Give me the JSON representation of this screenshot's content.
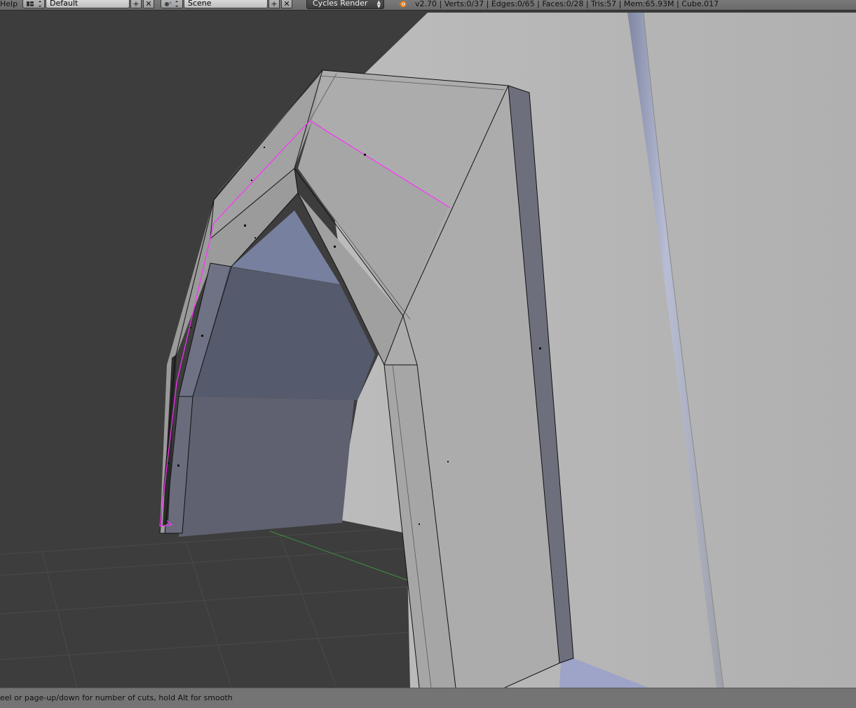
{
  "header": {
    "help_menu": "Help",
    "layout_name": "Default",
    "scene_name": "Scene",
    "render_engine": "Cycles Render",
    "stats": "v2.70 | Verts:0/37 | Edges:0/65 | Faces:0/28 | Tris:57 | Mem:65.93M | Cube.017",
    "add_icon": "plus-icon",
    "remove_icon": "close-icon",
    "layout_icon": "screen-layout-icon",
    "scene_icon": "scene-icon",
    "blender_icon": "blender-logo-icon"
  },
  "status_bar": {
    "hint": "eel or page-up/down for number of cuts, hold Alt for smooth"
  },
  "colors": {
    "background": "#3d3d3d",
    "mesh_face": "#a9a9a9",
    "selection_edge": "#ff30ff",
    "x_axis": "#8a2a2a",
    "y_axis": "#3e8f3e"
  }
}
